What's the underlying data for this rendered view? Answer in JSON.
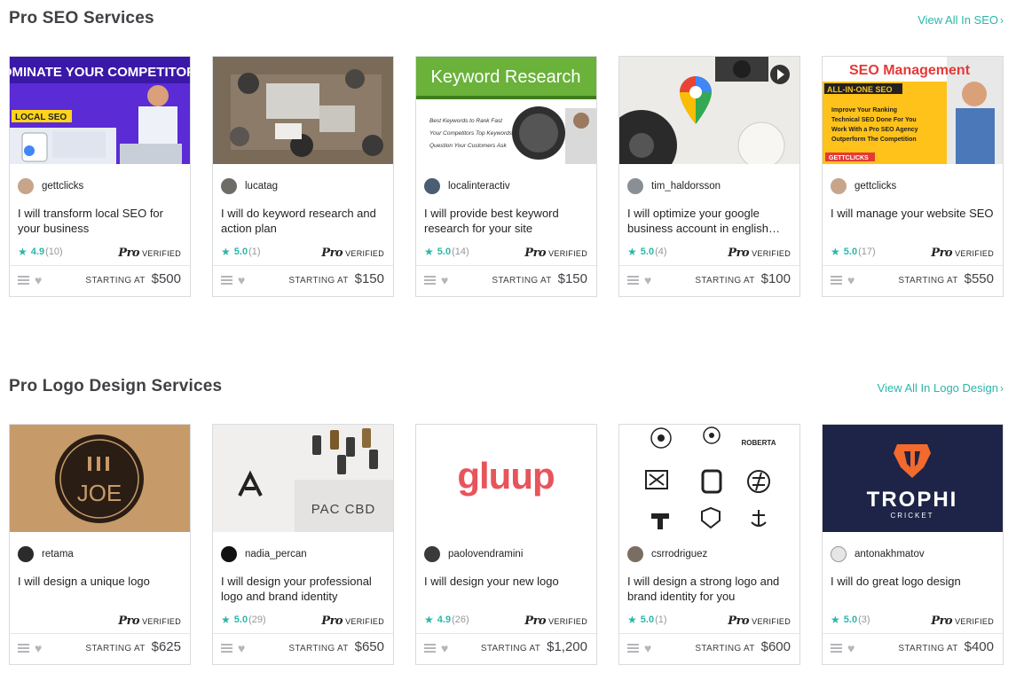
{
  "seo_section": {
    "title": "Pro SEO Services",
    "view_all": "View All In SEO",
    "cards": [
      {
        "seller": "gettclicks",
        "title": "I will transform local SEO for your business",
        "rating": "4.9",
        "count": "(10)",
        "price": "$500"
      },
      {
        "seller": "lucatag",
        "title": "I will do keyword research and action plan",
        "rating": "5.0",
        "count": "(1)",
        "price": "$150"
      },
      {
        "seller": "localinteractiv",
        "title": "I will provide best keyword research for your site",
        "rating": "5.0",
        "count": "(14)",
        "price": "$150"
      },
      {
        "seller": "tim_haldorsson",
        "title": "I will optimize your google business account in english…",
        "rating": "5.0",
        "count": "(4)",
        "price": "$100"
      },
      {
        "seller": "gettclicks",
        "title": "I will manage your website SEO",
        "rating": "5.0",
        "count": "(17)",
        "price": "$550"
      }
    ]
  },
  "logo_section": {
    "title": "Pro Logo Design Services",
    "view_all": "View All In Logo Design",
    "cards": [
      {
        "seller": "retama",
        "title": "I will design a unique logo",
        "rating": "",
        "count": "",
        "price": "$625"
      },
      {
        "seller": "nadia_percan",
        "title": "I will design your professional logo and brand identity",
        "rating": "5.0",
        "count": "(29)",
        "price": "$650"
      },
      {
        "seller": "paolovendramini",
        "title": "I will design your new logo",
        "rating": "4.9",
        "count": "(26)",
        "price": "$1,200"
      },
      {
        "seller": "csrrodriguez",
        "title": "I will design a strong logo and brand identity for you",
        "rating": "5.0",
        "count": "(1)",
        "price": "$600"
      },
      {
        "seller": "antonakhmatov",
        "title": "I will do great logo design",
        "rating": "5.0",
        "count": "(3)",
        "price": "$400"
      }
    ]
  },
  "labels": {
    "starting_at": "STARTING AT",
    "pro_mark": "Pro",
    "verified": "VERIFIED"
  },
  "thumbs": {
    "seo_1": {
      "headline": "DOMINATE YOUR COMPETITORS",
      "badge": "LOCAL SEO"
    },
    "seo_3": {
      "headline": "Keyword Research",
      "lines": [
        "Best Keywords to Rank Fast",
        "Your Competitors Top Keywords",
        "Question Your Customers Ask"
      ]
    },
    "seo_5": {
      "headline": "SEO Management",
      "sub": "ALL-IN-ONE SEO",
      "bullets": [
        "Improve Your Ranking",
        "Technical SEO Done For You",
        "Work With a Pro SEO Agency",
        "Outperform The Competition"
      ],
      "brand": "GETTCLICKS"
    },
    "logo_1": {
      "text": "JOE"
    },
    "logo_2": {
      "text": "PAC CBD"
    },
    "logo_3": {
      "text": "gluup"
    },
    "logo_4": {
      "text": "ROBERTA"
    },
    "logo_5": {
      "text": "TROPHI",
      "sub": "CRICKET"
    }
  },
  "colors": {
    "accent": "#2ab7a9",
    "text": "#404145",
    "border": "#dadbdd"
  }
}
